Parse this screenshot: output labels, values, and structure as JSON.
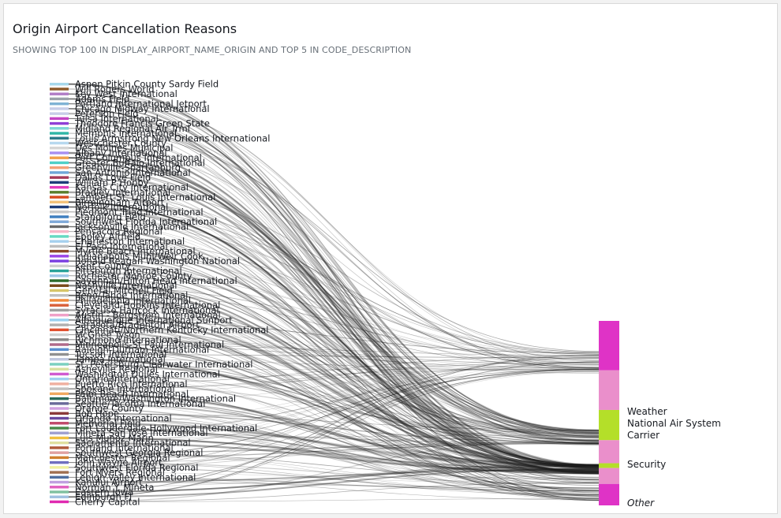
{
  "header": {
    "title": "Origin Airport Cancellation Reasons",
    "subtitle": "SHOWING TOP 100 IN DISPLAY_AIRPORT_NAME_ORIGIN AND TOP 5 IN CODE_DESCRIPTION"
  },
  "chart_data": {
    "type": "sankey",
    "source_field": "DISPLAY_AIRPORT_NAME_ORIGIN",
    "target_field": "CODE_DESCRIPTION",
    "sources": [
      {
        "name": "Aspen Pitkin County Sardy Field",
        "color": "#a6d8ec"
      },
      {
        "name": "Will Rogers World",
        "color": "#8c5a2b"
      },
      {
        "name": "Key West International",
        "color": "#b07cc6"
      },
      {
        "name": "Adams Field",
        "color": "#9aa3aa"
      },
      {
        "name": "Portland International Jetport",
        "color": "#7fb3d5"
      },
      {
        "name": "Chicago Midway International",
        "color": "#c7cde8"
      },
      {
        "name": "Peterson Field",
        "color": "#c7cde8"
      },
      {
        "name": "Tulsa International",
        "color": "#c445c4"
      },
      {
        "name": "Theodore Francis Green State",
        "color": "#8f3fd6"
      },
      {
        "name": "Midland Regional Air Trml",
        "color": "#7fd6d6"
      },
      {
        "name": "Memphis International",
        "color": "#2fb6a6"
      },
      {
        "name": "Louis Armstrong New Orleans International",
        "color": "#2e7a8a"
      },
      {
        "name": "Westchester County",
        "color": "#b7d8ef"
      },
      {
        "name": "Des Moines Municipal",
        "color": "#d5d5d5"
      },
      {
        "name": "Albany International",
        "color": "#a78ff0"
      },
      {
        "name": "Port Columbus International",
        "color": "#f0a04b"
      },
      {
        "name": "Greater Buffalo International",
        "color": "#4fd0c8"
      },
      {
        "name": "Greenville-Spartanburg",
        "color": "#f3a27a"
      },
      {
        "name": "San Antonio International",
        "color": "#6fa7d8"
      },
      {
        "name": "Dallas Love Field",
        "color": "#a53a5a"
      },
      {
        "name": "William P Hobby",
        "color": "#1f3d7a"
      },
      {
        "name": "Kansas City International",
        "color": "#e23bbd"
      },
      {
        "name": "Bradley International",
        "color": "#5b7d2b"
      },
      {
        "name": "Lambert-St. Louis International",
        "color": "#d94a1e"
      },
      {
        "name": "Birmingham Airport",
        "color": "#f4c27a"
      },
      {
        "name": "Norfolk International",
        "color": "#1f3d7a"
      },
      {
        "name": "Piedmont Triad International",
        "color": "#c9c9c9"
      },
      {
        "name": "Standiford Field",
        "color": "#3f7fbf"
      },
      {
        "name": "Southwest Florida International",
        "color": "#7fa9d8"
      },
      {
        "name": "Jacksonville International",
        "color": "#6b6b6b"
      },
      {
        "name": "Pensacola Regional",
        "color": "#f6b7c8"
      },
      {
        "name": "Eppley Airfield",
        "color": "#66d9c2"
      },
      {
        "name": "Charleston International",
        "color": "#a6d0ee"
      },
      {
        "name": "El Paso International",
        "color": "#bdbdbd"
      },
      {
        "name": "Myrtle Beach International",
        "color": "#8c4a2b"
      },
      {
        "name": "Indianapolis Muni/Weir Cook",
        "color": "#9b45e8"
      },
      {
        "name": "Ronald Reagan Washington National",
        "color": "#7a3fe0"
      },
      {
        "name": "Kent County",
        "color": "#cfcfcf"
      },
      {
        "name": "Pittsburgh International",
        "color": "#2aa39a"
      },
      {
        "name": "Rochester Monroe County",
        "color": "#9ec8e8"
      },
      {
        "name": "Savannah/Hilton Head International",
        "color": "#2c6b2c"
      },
      {
        "name": "Nashville International",
        "color": "#7a4a1a"
      },
      {
        "name": "General Mitchell Field",
        "color": "#d7c66a"
      },
      {
        "name": "Reno/Tahoe International",
        "color": "#c0c0c0"
      },
      {
        "name": "Philadelphia International",
        "color": "#f08a3c"
      },
      {
        "name": "Cleveland-Hopkins International",
        "color": "#d9603a"
      },
      {
        "name": "Syracuse Hancock International",
        "color": "#a0a0a0"
      },
      {
        "name": "Austin - Bergstrom International",
        "color": "#f0a0c8"
      },
      {
        "name": "Albuquerque International Sunport",
        "color": "#9ad0f0"
      },
      {
        "name": "Sarasota/Bradenton Airport",
        "color": "#b0b0b0"
      },
      {
        "name": "Cincinnati/Northern Kentucky International",
        "color": "#e05030"
      },
      {
        "name": "McGhee Tyson",
        "color": "#d0d0d0"
      },
      {
        "name": "Richmond International",
        "color": "#888888"
      },
      {
        "name": "Minneapolis-St Paul International",
        "color": "#b06a8a"
      },
      {
        "name": "Raleigh-Durham International",
        "color": "#5a8fd0"
      },
      {
        "name": "Tucson International",
        "color": "#909090"
      },
      {
        "name": "Tampa International",
        "color": "#c0c8e0"
      },
      {
        "name": "St. Petersburg-Clearwater International",
        "color": "#7ad0c0"
      },
      {
        "name": "Asheville Regional",
        "color": "#d8e0a0"
      },
      {
        "name": "Washington Dulles International",
        "color": "#d05ad0"
      },
      {
        "name": "Ontario International",
        "color": "#a0d0f0"
      },
      {
        "name": "Puerto Rico International",
        "color": "#f0b0a0"
      },
      {
        "name": "Spokane International",
        "color": "#c0c0c0"
      },
      {
        "name": "Palm Beach International",
        "color": "#f0a860"
      },
      {
        "name": "Baltimore/Washington International",
        "color": "#2a6a5a"
      },
      {
        "name": "Seattle/Tacoma International",
        "color": "#6a6a9a"
      },
      {
        "name": "Orange County",
        "color": "#d0a0e0"
      },
      {
        "name": "Bob Hope",
        "color": "#8a3a3a"
      },
      {
        "name": "Orlando International",
        "color": "#6a4aa0"
      },
      {
        "name": "Memorial Field",
        "color": "#c04a6a"
      },
      {
        "name": "Fort Lauderdale-Hollywood International",
        "color": "#4a8a4a"
      },
      {
        "name": "Mineta San Jose International",
        "color": "#a0a0d0"
      },
      {
        "name": "Luis Munoz Marin",
        "color": "#f0c040"
      },
      {
        "name": "Sacramento International",
        "color": "#e0e0a0"
      },
      {
        "name": "Portland International",
        "color": "#b05a3a"
      },
      {
        "name": "Southwest Georgia Regional",
        "color": "#e0a0a0"
      },
      {
        "name": "Manchester Regional",
        "color": "#d08030"
      },
      {
        "name": "John Wayne Airport",
        "color": "#7070c0"
      },
      {
        "name": "Southwest Florida Regional",
        "color": "#f0f0a0"
      },
      {
        "name": "Fort Myers Regional",
        "color": "#a07050"
      },
      {
        "name": "Lehigh Valley International",
        "color": "#5070a0"
      },
      {
        "name": "Kahului Airport",
        "color": "#c0a0e0"
      },
      {
        "name": "Norman Y. Mineta",
        "color": "#e060c0"
      },
      {
        "name": "Eastern Iowa",
        "color": "#80c0a0"
      },
      {
        "name": "Edinburgh Fl",
        "color": "#a0c0e0"
      },
      {
        "name": "Cherry Capital",
        "color": "#e02ab0"
      }
    ],
    "targets": [
      {
        "name": "Weather",
        "color": "#df33c6"
      },
      {
        "name": "National Air System",
        "color": "#ea8fcb"
      },
      {
        "name": "Carrier",
        "color": "#b4df29"
      },
      {
        "name": "Security",
        "color": "#b4df29"
      },
      {
        "name": "Other",
        "color": "#df33c6"
      }
    ],
    "visible_target_labels": [
      "Weather",
      "National Air System",
      "Carrier",
      "Security",
      "Other"
    ],
    "target_segments": [
      {
        "target": "Weather",
        "color": "#df33c6",
        "weight": 62
      },
      {
        "target": "National Air System",
        "color": "#ea8fcb",
        "weight": 50
      },
      {
        "target": "Carrier",
        "color": "#b4df29",
        "weight": 38
      },
      {
        "target": "Carrier",
        "color": "#ea8fcb",
        "weight": 29
      },
      {
        "target": "Security",
        "color": "#b4df29",
        "weight": 6
      },
      {
        "target": "Security",
        "color": "#ea8fcb",
        "weight": 20
      },
      {
        "target": "Other",
        "color": "#df33c6",
        "weight": 27
      }
    ],
    "link_color": "#1b1b1b"
  }
}
